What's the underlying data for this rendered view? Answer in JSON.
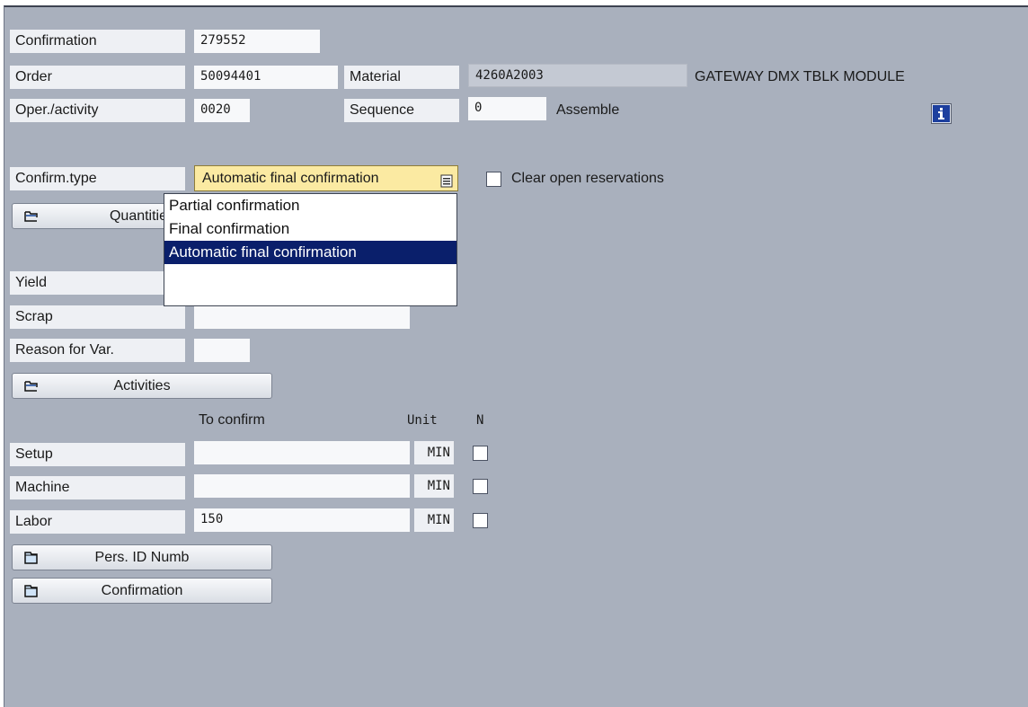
{
  "header": {
    "confirmation_label": "Confirmation",
    "confirmation_value": "279552",
    "order_label": "Order",
    "order_value": "50094401",
    "material_label": "Material",
    "material_value": "4260A2003",
    "material_desc": "GATEWAY DMX TBLK MODULE",
    "oper_label": "Oper./activity",
    "oper_value": "0020",
    "sequence_label": "Sequence",
    "sequence_value": "0",
    "oper_desc": "Assemble",
    "info_icon": "info-icon"
  },
  "confirm_type": {
    "label": "Confirm.type",
    "selected": "Automatic final confirmation",
    "options": [
      "Partial confirmation",
      "Final confirmation",
      "Automatic final confirmation"
    ],
    "selected_index": 2,
    "clear_res_label": "Clear open reservations",
    "clear_res_checked": false
  },
  "quantities": {
    "button_label": "Quantities",
    "yield_label": "Yield",
    "scrap_label": "Scrap",
    "reason_label": "Reason for Var."
  },
  "activities": {
    "button_label": "Activities",
    "to_confirm_header": "To confirm",
    "unit_header": "Unit",
    "n_header": "N",
    "rows": [
      {
        "label": "Setup",
        "value": "",
        "unit": "MIN",
        "checked": false
      },
      {
        "label": "Machine",
        "value": "",
        "unit": "MIN",
        "checked": false
      },
      {
        "label": "Labor",
        "value": "150",
        "unit": "MIN",
        "checked": false
      }
    ]
  },
  "buttons": {
    "pers_id_label": "Pers. ID Numb",
    "confirmation_label": "Confirmation"
  },
  "colors": {
    "background": "#a9b0bd",
    "dropdown_bg": "#fbeaa2",
    "selection": "#0a1f6b"
  }
}
